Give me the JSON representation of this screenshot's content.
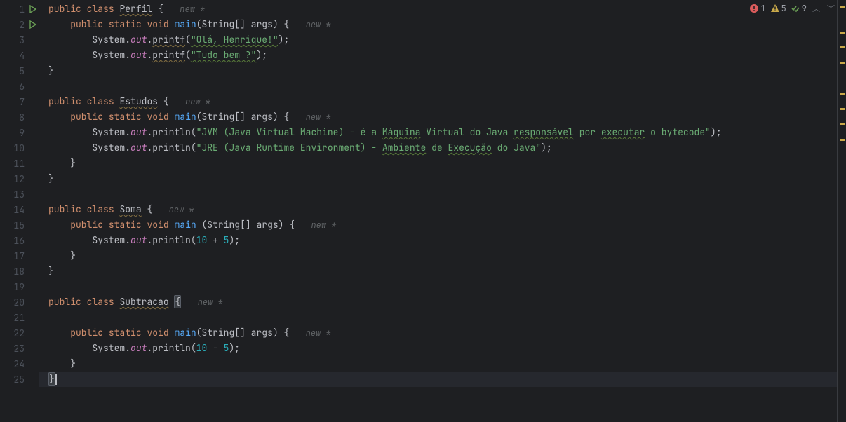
{
  "status": {
    "errors": "1",
    "warnings": "5",
    "weak": "9"
  },
  "hints": {
    "new": "new *"
  },
  "code": {
    "l1": {
      "public": "public",
      "class": "class",
      "name": "Perfil",
      "brace": "{"
    },
    "l2": {
      "public": "public",
      "static": "static",
      "void": "void",
      "main": "main",
      "sig": "(String[] args) {"
    },
    "l3": {
      "system": "System.",
      "out": "out",
      "dot": ".",
      "method": "printf",
      "open": "(",
      "str": "\"Olá, Henrique!\"",
      "close": ");"
    },
    "l4": {
      "system": "System.",
      "out": "out",
      "dot": ".",
      "method": "printf",
      "open": "(",
      "str": "\"Tudo bem ?\"",
      "close": ");"
    },
    "l5": {
      "brace": "}"
    },
    "l7": {
      "public": "public",
      "class": "class",
      "name": "Estudos",
      "brace": "{"
    },
    "l8": {
      "public": "public",
      "static": "static",
      "void": "void",
      "main": "main",
      "sig": "(String[] args) {"
    },
    "l9": {
      "system": "System.",
      "out": "out",
      "dot": ".",
      "method": "println",
      "open": "(",
      "s1": "\"JVM (Java Virtual Machine) - é a ",
      "s2": "Máquina",
      "s3": " Virtual do Java ",
      "s4": "responsável",
      "s5": " por ",
      "s6": "executar",
      "s7": " o bytecode\"",
      "close": ");"
    },
    "l10": {
      "system": "System.",
      "out": "out",
      "dot": ".",
      "method": "println",
      "open": "(",
      "s1": "\"JRE (Java Runtime Environment) - ",
      "s2": "Ambiente",
      "s3": " de ",
      "s4": "Execução",
      "s5": " do Java\"",
      "close": ");"
    },
    "l11": {
      "brace": "}"
    },
    "l12": {
      "brace": "}"
    },
    "l14": {
      "public": "public",
      "class": "class",
      "name": "Soma",
      "brace": "{"
    },
    "l15": {
      "public": "public",
      "static": "static",
      "void": "void",
      "main": "main",
      "sig": " (String[] args) {"
    },
    "l16": {
      "system": "System.",
      "out": "out",
      "dot": ".",
      "method": "println",
      "open": "(",
      "n1": "10",
      "op": " + ",
      "n2": "5",
      "close": ");"
    },
    "l17": {
      "brace": "}"
    },
    "l18": {
      "brace": "}"
    },
    "l20": {
      "public": "public",
      "class": "class",
      "name": "Subtracao",
      "brace": "{"
    },
    "l22": {
      "public": "public",
      "static": "static",
      "void": "void",
      "main": "main",
      "sig": "(String[] args) {"
    },
    "l23": {
      "system": "System.",
      "out": "out",
      "dot": ".",
      "method": "println",
      "open": "(",
      "n1": "10",
      "op": " - ",
      "n2": "5",
      "close": ");"
    },
    "l24": {
      "brace": "}"
    },
    "l25": {
      "brace": "}"
    }
  },
  "lines": [
    "1",
    "2",
    "3",
    "4",
    "5",
    "6",
    "7",
    "8",
    "9",
    "10",
    "11",
    "12",
    "13",
    "14",
    "15",
    "16",
    "17",
    "18",
    "19",
    "20",
    "21",
    "22",
    "23",
    "24",
    "25"
  ]
}
